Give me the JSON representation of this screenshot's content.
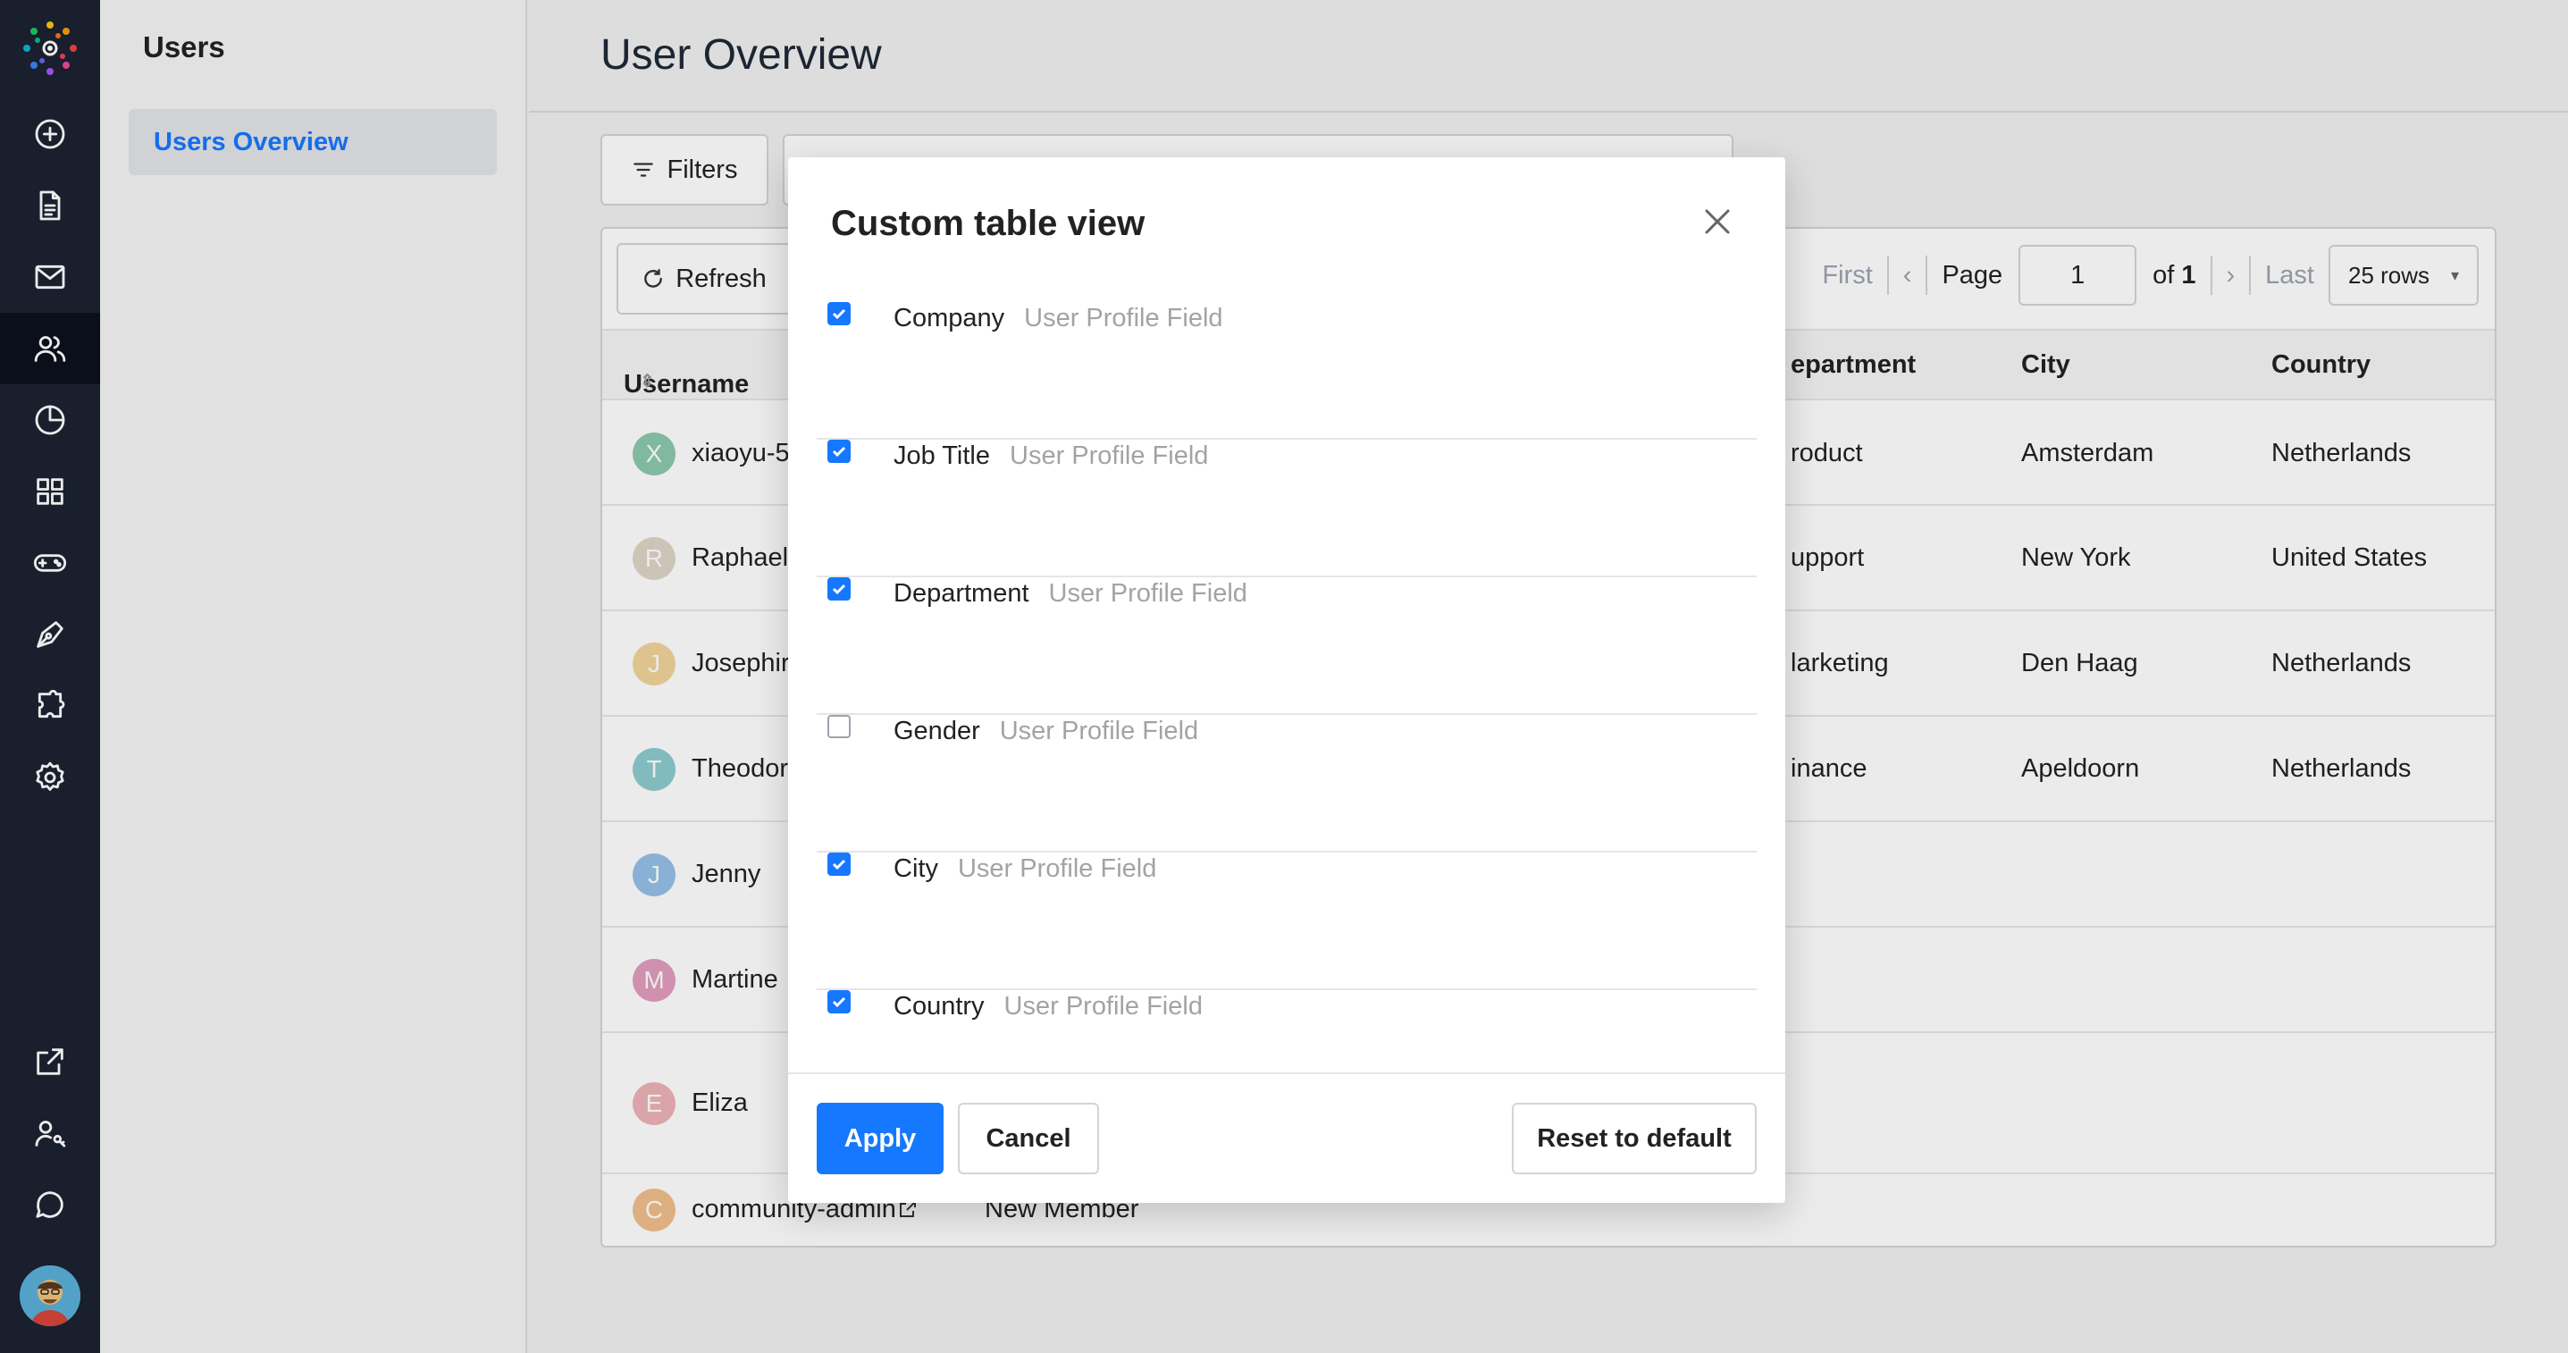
{
  "rail": {
    "icons": [
      "add-circle-icon",
      "document-icon",
      "mail-icon",
      "users-icon",
      "pie-chart-icon",
      "grid-icon",
      "gamepad-icon",
      "pen-tool-icon",
      "puzzle-icon",
      "gear-icon",
      "external-link-icon",
      "user-key-icon",
      "chat-icon"
    ],
    "active": "users-icon"
  },
  "sidebar": {
    "title": "Users",
    "items": [
      {
        "label": "Users Overview"
      }
    ]
  },
  "main": {
    "title": "User Overview",
    "filters_label": "Filters",
    "refresh_label": "Refresh",
    "pager": {
      "first": "First",
      "page_label": "Page",
      "page_value": "1",
      "of_label": "of",
      "total_pages": "1",
      "last": "Last",
      "rows": "25 rows"
    },
    "columns": {
      "username": "Username",
      "department": "epartment",
      "city": "City",
      "country": "Country"
    },
    "rows": [
      {
        "initial": "X",
        "color": "#2e9e6b",
        "username": "xiaoyu-5",
        "department": "roduct",
        "city": "Amsterdam",
        "country": "Netherlands"
      },
      {
        "initial": "R",
        "color": "#c4b49a",
        "username": "Raphael",
        "department": "upport",
        "city": "New York",
        "country": "United States"
      },
      {
        "initial": "J",
        "color": "#e9b24a",
        "username": "Josephir",
        "department": "larketing",
        "city": "Den Haag",
        "country": "Netherlands"
      },
      {
        "initial": "T",
        "color": "#2fa2a8",
        "username": "Theodor",
        "department": "inance",
        "city": "Apeldoorn",
        "country": "Netherlands"
      },
      {
        "initial": "J",
        "color": "#3f8fd6",
        "username": "Jenny",
        "department": "",
        "city": "",
        "country": ""
      },
      {
        "initial": "M",
        "color": "#c9508a",
        "username": "Martine",
        "department": "",
        "city": "",
        "country": ""
      },
      {
        "initial": "E",
        "color": "#e0787e",
        "username": "Eliza",
        "department": "",
        "city": "",
        "country": ""
      },
      {
        "initial": "C",
        "color": "#e68a2e",
        "username": "community-admin",
        "role": "New Member",
        "department": "",
        "city": "",
        "country": ""
      }
    ]
  },
  "modal": {
    "title": "Custom table view",
    "type_label": "User Profile Field",
    "fields": [
      {
        "name": "Company",
        "checked": true
      },
      {
        "name": "Job Title",
        "checked": true
      },
      {
        "name": "Department",
        "checked": true
      },
      {
        "name": "Gender",
        "checked": false
      },
      {
        "name": "City",
        "checked": true
      },
      {
        "name": "Country",
        "checked": true
      }
    ],
    "apply_label": "Apply",
    "cancel_label": "Cancel",
    "reset_label": "Reset to default"
  },
  "colors": {
    "accent": "#1677ff",
    "rail_bg": "#1c2231"
  }
}
